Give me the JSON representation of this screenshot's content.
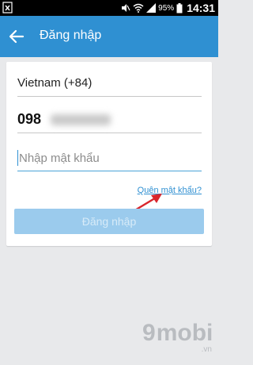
{
  "status_bar": {
    "battery_percent": "95%",
    "time": "14:31",
    "icons": [
      "notification-x-icon",
      "mute-icon",
      "wifi-icon",
      "signal-icon",
      "battery-icon"
    ]
  },
  "app_bar": {
    "title": "Đăng nhập",
    "background": "#2f90d2"
  },
  "form": {
    "country": "Vietnam (+84)",
    "phone_visible_prefix": "098",
    "password_placeholder": "Nhập mật khẩu",
    "forgot_password": "Quên mật khẩu?",
    "login_button": "Đăng nhập",
    "login_button_state": "disabled"
  },
  "annotation": {
    "arrow_color": "#d9262c",
    "points_to": "forgot-password-link"
  },
  "watermark": {
    "logo": "9mobi",
    "domain": ".vn"
  }
}
